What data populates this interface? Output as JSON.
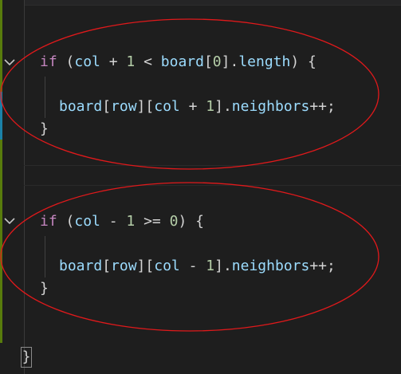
{
  "editor": {
    "top_hint_text": "",
    "blocks": [
      {
        "lines": [
          {
            "tokens": [
              {
                "text": "if",
                "kind": "kw"
              },
              {
                "text": " (",
                "kind": "op"
              },
              {
                "text": "col",
                "kind": "var"
              },
              {
                "text": " + ",
                "kind": "op"
              },
              {
                "text": "1",
                "kind": "num"
              },
              {
                "text": " < ",
                "kind": "op"
              },
              {
                "text": "board",
                "kind": "var"
              },
              {
                "text": "[",
                "kind": "op"
              },
              {
                "text": "0",
                "kind": "num"
              },
              {
                "text": "].",
                "kind": "op"
              },
              {
                "text": "length",
                "kind": "var"
              },
              {
                "text": ") {",
                "kind": "op"
              }
            ]
          },
          {
            "tokens": [
              {
                "text": "board",
                "kind": "var"
              },
              {
                "text": "[",
                "kind": "op"
              },
              {
                "text": "row",
                "kind": "var"
              },
              {
                "text": "][",
                "kind": "op"
              },
              {
                "text": "col",
                "kind": "var"
              },
              {
                "text": " + ",
                "kind": "op"
              },
              {
                "text": "1",
                "kind": "num"
              },
              {
                "text": "].",
                "kind": "op"
              },
              {
                "text": "neighbors",
                "kind": "var"
              },
              {
                "text": "++;",
                "kind": "op"
              }
            ]
          },
          {
            "tokens": [
              {
                "text": "}",
                "kind": "op"
              }
            ]
          }
        ]
      },
      {
        "lines": [
          {
            "tokens": [
              {
                "text": "if",
                "kind": "kw"
              },
              {
                "text": " (",
                "kind": "op"
              },
              {
                "text": "col",
                "kind": "var"
              },
              {
                "text": " - ",
                "kind": "op"
              },
              {
                "text": "1",
                "kind": "num"
              },
              {
                "text": " >= ",
                "kind": "op"
              },
              {
                "text": "0",
                "kind": "num"
              },
              {
                "text": ") {",
                "kind": "op"
              }
            ]
          },
          {
            "tokens": [
              {
                "text": "board",
                "kind": "var"
              },
              {
                "text": "[",
                "kind": "op"
              },
              {
                "text": "row",
                "kind": "var"
              },
              {
                "text": "][",
                "kind": "op"
              },
              {
                "text": "col",
                "kind": "var"
              },
              {
                "text": " - ",
                "kind": "op"
              },
              {
                "text": "1",
                "kind": "num"
              },
              {
                "text": "].",
                "kind": "op"
              },
              {
                "text": "neighbors",
                "kind": "var"
              },
              {
                "text": "++;",
                "kind": "op"
              }
            ]
          },
          {
            "tokens": [
              {
                "text": "}",
                "kind": "op"
              }
            ]
          }
        ]
      }
    ],
    "closing_brace": "}",
    "fold_icon": "chevron-down-icon"
  },
  "annotations": {
    "ellipse_color": "#e0191b",
    "count": 2
  },
  "colors": {
    "background": "#1e1e1e",
    "keyword": "#c586c0",
    "variable": "#9cdcfe",
    "number": "#b5cea8",
    "punctuation": "#d4d4d4",
    "gutter_green": "#6a8a2a",
    "gutter_blue": "#1f6aa5"
  }
}
